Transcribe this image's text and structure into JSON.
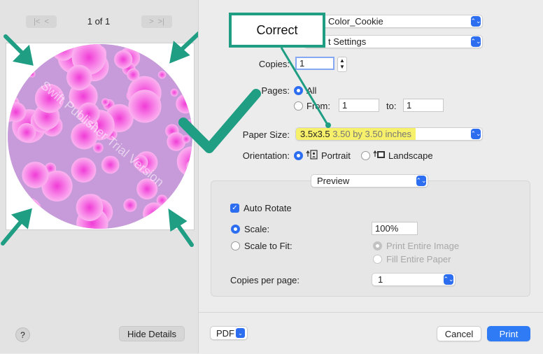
{
  "preview": {
    "page_indicator": "1 of 1",
    "first_button": "|<",
    "prev_button": "<",
    "next_button": ">",
    "last_button": ">|",
    "watermark": "Swift Publisher Trial Version",
    "hide_details_label": "Hide Details",
    "help_label": "?"
  },
  "annotation": {
    "callout_text": "Correct",
    "accent_color": "#1f9e84"
  },
  "printer": {
    "printer_value": "Color_Cookie",
    "presets_value": "t Settings"
  },
  "copies": {
    "label": "Copies:",
    "value": "1"
  },
  "pages": {
    "label": "Pages:",
    "all_label": "All",
    "from_label": "From:",
    "from_value": "1",
    "to_label": "to:",
    "to_value": "1"
  },
  "paper_size": {
    "label": "Paper Size:",
    "name": "3.5x3.5",
    "dims": "3.50 by 3.50 inches",
    "highlight_color": "#f7f06a"
  },
  "orientation": {
    "label": "Orientation:",
    "portrait_label": "Portrait",
    "landscape_label": "Landscape"
  },
  "section": {
    "app_popup_value": "Preview",
    "auto_rotate_label": "Auto Rotate",
    "scale_label": "Scale:",
    "scale_value": "100%",
    "scale_to_fit_label": "Scale to Fit:",
    "print_entire_image_label": "Print Entire Image",
    "fill_entire_paper_label": "Fill Entire Paper",
    "copies_per_page_label": "Copies per page:",
    "copies_per_page_value": "1"
  },
  "footer": {
    "pdf_label": "PDF",
    "cancel_label": "Cancel",
    "print_label": "Print"
  }
}
